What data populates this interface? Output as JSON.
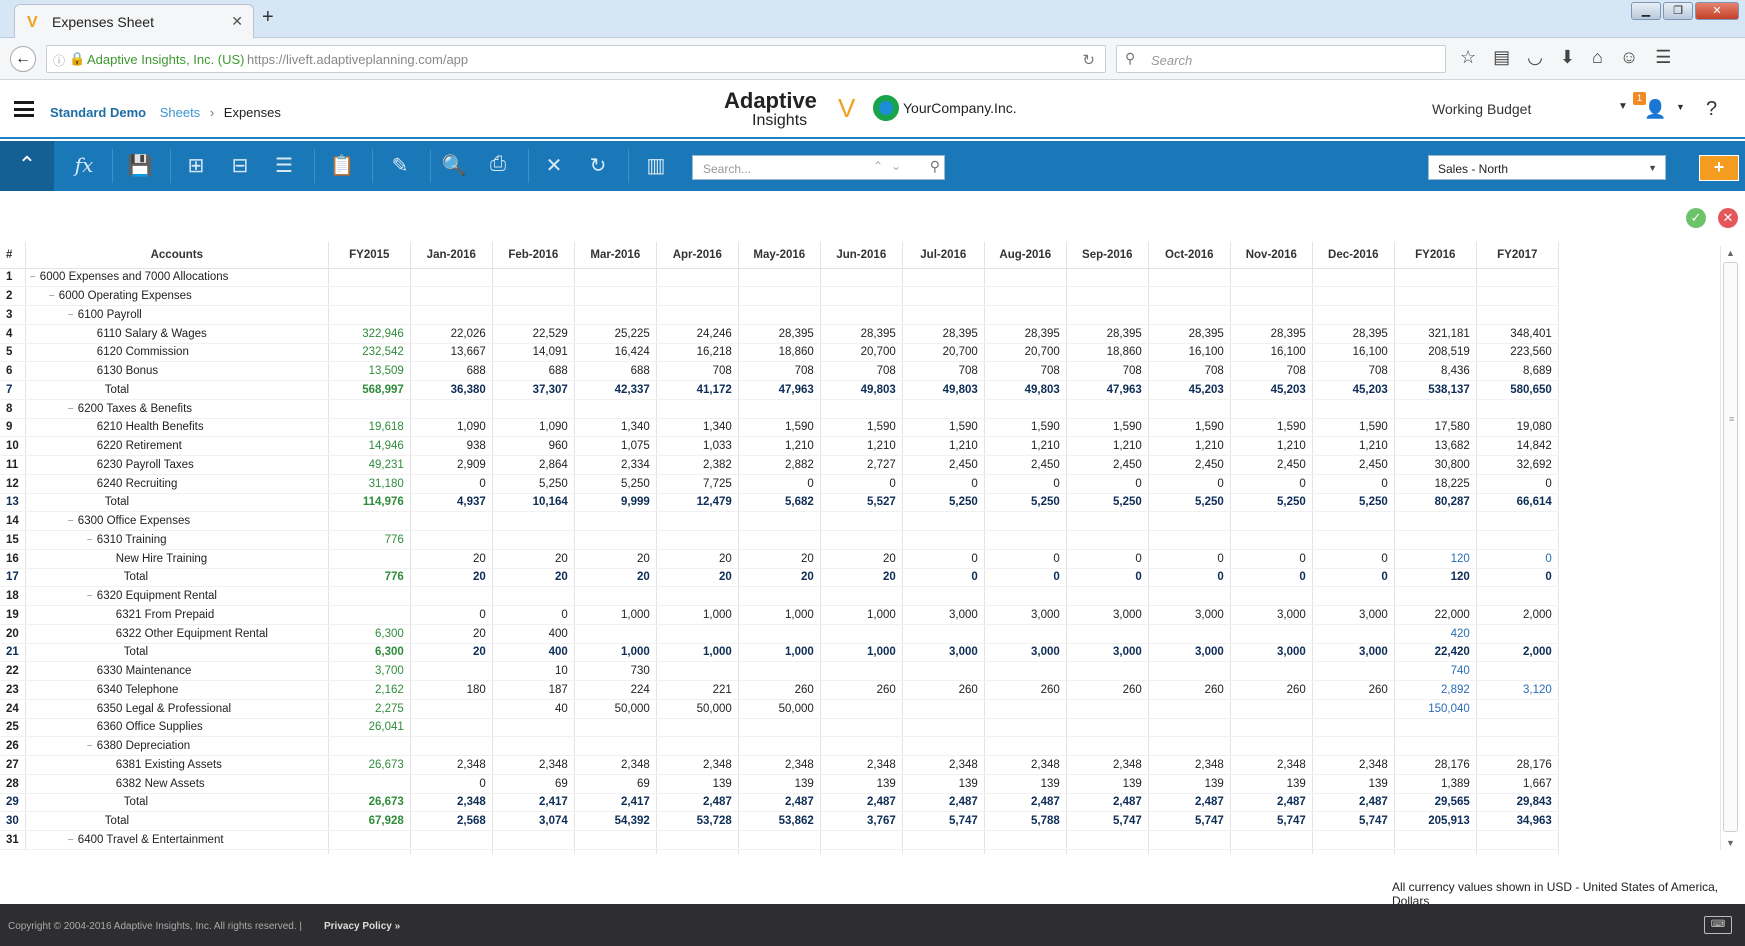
{
  "browser": {
    "tab_title": "Expenses Sheet",
    "new_tab": "+",
    "site_org": "Adaptive Insights, Inc. (US)",
    "url": "https://liveft.adaptiveplanning.com/app",
    "search_placeholder": "Search"
  },
  "header": {
    "breadcrumb": {
      "root": "Standard Demo",
      "section": "Sheets",
      "separator": "›",
      "current": "Expenses"
    },
    "brand_line1": "Adaptive",
    "brand_line2": "Insights",
    "company": "YourCompany.Inc.",
    "version": "Working Budget",
    "notifications": "1",
    "help": "?"
  },
  "toolbar": {
    "search_placeholder": "Search...",
    "sheet_selector": "Sales - North",
    "add_label": "+"
  },
  "grid": {
    "columns": [
      "#",
      "Accounts",
      "FY2015",
      "Jan-2016",
      "Feb-2016",
      "Mar-2016",
      "Apr-2016",
      "May-2016",
      "Jun-2016",
      "Jul-2016",
      "Aug-2016",
      "Sep-2016",
      "Oct-2016",
      "Nov-2016",
      "Dec-2016",
      "FY2016",
      "FY2017"
    ],
    "rows": [
      {
        "n": "1",
        "indent": 0,
        "toggle": "−",
        "account": "6000 Expenses and 7000 Allocations",
        "values": [
          "",
          "",
          "",
          "",
          "",
          "",
          "",
          "",
          "",
          "",
          "",
          "",
          "",
          "",
          ""
        ]
      },
      {
        "n": "2",
        "indent": 1,
        "toggle": "−",
        "account": "6000 Operating Expenses",
        "values": [
          "",
          "",
          "",
          "",
          "",
          "",
          "",
          "",
          "",
          "",
          "",
          "",
          "",
          "",
          ""
        ]
      },
      {
        "n": "3",
        "indent": 2,
        "toggle": "−",
        "account": "6100 Payroll",
        "values": [
          "",
          "",
          "",
          "",
          "",
          "",
          "",
          "",
          "",
          "",
          "",
          "",
          "",
          "",
          ""
        ]
      },
      {
        "n": "4",
        "indent": 3,
        "account": "6110 Salary & Wages",
        "values": [
          "322,946",
          "22,026",
          "22,529",
          "25,225",
          "24,246",
          "28,395",
          "28,395",
          "28,395",
          "28,395",
          "28,395",
          "28,395",
          "28,395",
          "28,395",
          "321,181",
          "348,401"
        ]
      },
      {
        "n": "5",
        "indent": 3,
        "account": "6120 Commission",
        "values": [
          "232,542",
          "13,667",
          "14,091",
          "16,424",
          "16,218",
          "18,860",
          "20,700",
          "20,700",
          "20,700",
          "18,860",
          "16,100",
          "16,100",
          "16,100",
          "208,519",
          "223,560"
        ]
      },
      {
        "n": "6",
        "indent": 3,
        "account": "6130 Bonus",
        "values": [
          "13,509",
          "688",
          "688",
          "688",
          "708",
          "708",
          "708",
          "708",
          "708",
          "708",
          "708",
          "708",
          "708",
          "8,436",
          "8,689"
        ]
      },
      {
        "n": "7",
        "indent": 3,
        "total": true,
        "account": "Total",
        "values": [
          "568,997",
          "36,380",
          "37,307",
          "42,337",
          "41,172",
          "47,963",
          "49,803",
          "49,803",
          "49,803",
          "47,963",
          "45,203",
          "45,203",
          "45,203",
          "538,137",
          "580,650"
        ]
      },
      {
        "n": "8",
        "indent": 2,
        "toggle": "−",
        "account": "6200 Taxes & Benefits",
        "values": [
          "",
          "",
          "",
          "",
          "",
          "",
          "",
          "",
          "",
          "",
          "",
          "",
          "",
          "",
          ""
        ]
      },
      {
        "n": "9",
        "indent": 3,
        "account": "6210 Health Benefits",
        "values": [
          "19,618",
          "1,090",
          "1,090",
          "1,340",
          "1,340",
          "1,590",
          "1,590",
          "1,590",
          "1,590",
          "1,590",
          "1,590",
          "1,590",
          "1,590",
          "17,580",
          "19,080"
        ]
      },
      {
        "n": "10",
        "indent": 3,
        "account": "6220 Retirement",
        "values": [
          "14,946",
          "938",
          "960",
          "1,075",
          "1,033",
          "1,210",
          "1,210",
          "1,210",
          "1,210",
          "1,210",
          "1,210",
          "1,210",
          "1,210",
          "13,682",
          "14,842"
        ]
      },
      {
        "n": "11",
        "indent": 3,
        "account": "6230 Payroll Taxes",
        "values": [
          "49,231",
          "2,909",
          "2,864",
          "2,334",
          "2,382",
          "2,882",
          "2,727",
          "2,450",
          "2,450",
          "2,450",
          "2,450",
          "2,450",
          "2,450",
          "30,800",
          "32,692"
        ]
      },
      {
        "n": "12",
        "indent": 3,
        "account": "6240 Recruiting",
        "values": [
          "31,180",
          "0",
          "5,250",
          "5,250",
          "7,725",
          "0",
          "0",
          "0",
          "0",
          "0",
          "0",
          "0",
          "0",
          "18,225",
          "0"
        ]
      },
      {
        "n": "13",
        "indent": 3,
        "total": true,
        "account": "Total",
        "values": [
          "114,976",
          "4,937",
          "10,164",
          "9,999",
          "12,479",
          "5,682",
          "5,527",
          "5,250",
          "5,250",
          "5,250",
          "5,250",
          "5,250",
          "5,250",
          "80,287",
          "66,614"
        ]
      },
      {
        "n": "14",
        "indent": 2,
        "toggle": "−",
        "account": "6300 Office Expenses",
        "values": [
          "",
          "",
          "",
          "",
          "",
          "",
          "",
          "",
          "",
          "",
          "",
          "",
          "",
          "",
          ""
        ]
      },
      {
        "n": "15",
        "indent": 3,
        "toggle": "−",
        "account": "6310 Training",
        "values": [
          "776",
          "",
          "",
          "",
          "",
          "",
          "",
          "",
          "",
          "",
          "",
          "",
          "",
          "",
          ""
        ]
      },
      {
        "n": "16",
        "indent": 4,
        "account": "New Hire Training",
        "values": [
          "",
          "20",
          "20",
          "20",
          "20",
          "20",
          "20",
          "0",
          "0",
          "0",
          "0",
          "0",
          "0",
          "120",
          "0"
        ],
        "blue_fy": true
      },
      {
        "n": "17",
        "indent": 4,
        "total": true,
        "account": "Total",
        "values": [
          "776",
          "20",
          "20",
          "20",
          "20",
          "20",
          "20",
          "0",
          "0",
          "0",
          "0",
          "0",
          "0",
          "120",
          "0"
        ]
      },
      {
        "n": "18",
        "indent": 3,
        "toggle": "−",
        "account": "6320 Equipment Rental",
        "values": [
          "",
          "",
          "",
          "",
          "",
          "",
          "",
          "",
          "",
          "",
          "",
          "",
          "",
          "",
          ""
        ]
      },
      {
        "n": "19",
        "indent": 4,
        "account": "6321 From Prepaid",
        "values": [
          "",
          "0",
          "0",
          "1,000",
          "1,000",
          "1,000",
          "1,000",
          "3,000",
          "3,000",
          "3,000",
          "3,000",
          "3,000",
          "3,000",
          "22,000",
          "2,000"
        ]
      },
      {
        "n": "20",
        "indent": 4,
        "account": "6322 Other Equipment Rental",
        "values": [
          "6,300",
          "20",
          "400",
          "",
          "",
          "",
          "",
          "",
          "",
          "",
          "",
          "",
          "",
          "420",
          ""
        ],
        "blue_fy": true
      },
      {
        "n": "21",
        "indent": 4,
        "total": true,
        "account": "Total",
        "values": [
          "6,300",
          "20",
          "400",
          "1,000",
          "1,000",
          "1,000",
          "1,000",
          "3,000",
          "3,000",
          "3,000",
          "3,000",
          "3,000",
          "3,000",
          "22,420",
          "2,000"
        ]
      },
      {
        "n": "22",
        "indent": 3,
        "account": "6330 Maintenance",
        "values": [
          "3,700",
          "",
          "10",
          "730",
          "",
          "",
          "",
          "",
          "",
          "",
          "",
          "",
          "",
          "740",
          ""
        ],
        "blue_fy": true
      },
      {
        "n": "23",
        "indent": 3,
        "account": "6340 Telephone",
        "values": [
          "2,162",
          "180",
          "187",
          "224",
          "221",
          "260",
          "260",
          "260",
          "260",
          "260",
          "260",
          "260",
          "260",
          "2,892",
          "3,120"
        ],
        "blue_fy": true
      },
      {
        "n": "24",
        "indent": 3,
        "account": "6350 Legal & Professional",
        "values": [
          "2,275",
          "",
          "40",
          "50,000",
          "50,000",
          "50,000",
          "",
          "",
          "",
          "",
          "",
          "",
          "",
          "150,040",
          ""
        ],
        "blue_fy": true
      },
      {
        "n": "25",
        "indent": 3,
        "account": "6360 Office Supplies",
        "values": [
          "26,041",
          "",
          "",
          "",
          "",
          "",
          "",
          "",
          "",
          "",
          "",
          "",
          "",
          "",
          ""
        ]
      },
      {
        "n": "26",
        "indent": 3,
        "toggle": "−",
        "account": "6380 Depreciation",
        "values": [
          "",
          "",
          "",
          "",
          "",
          "",
          "",
          "",
          "",
          "",
          "",
          "",
          "",
          "",
          ""
        ]
      },
      {
        "n": "27",
        "indent": 4,
        "account": "6381 Existing Assets",
        "values": [
          "26,673",
          "2,348",
          "2,348",
          "2,348",
          "2,348",
          "2,348",
          "2,348",
          "2,348",
          "2,348",
          "2,348",
          "2,348",
          "2,348",
          "2,348",
          "28,176",
          "28,176"
        ]
      },
      {
        "n": "28",
        "indent": 4,
        "account": "6382 New Assets",
        "values": [
          "",
          "0",
          "69",
          "69",
          "139",
          "139",
          "139",
          "139",
          "139",
          "139",
          "139",
          "139",
          "139",
          "1,389",
          "1,667"
        ]
      },
      {
        "n": "29",
        "indent": 4,
        "total": true,
        "account": "Total",
        "values": [
          "26,673",
          "2,348",
          "2,417",
          "2,417",
          "2,487",
          "2,487",
          "2,487",
          "2,487",
          "2,487",
          "2,487",
          "2,487",
          "2,487",
          "2,487",
          "29,565",
          "29,843"
        ]
      },
      {
        "n": "30",
        "indent": 3,
        "total": true,
        "account": "Total",
        "values": [
          "67,928",
          "2,568",
          "3,074",
          "54,392",
          "53,728",
          "53,862",
          "3,767",
          "5,747",
          "5,788",
          "5,747",
          "5,747",
          "5,747",
          "5,747",
          "205,913",
          "34,963"
        ]
      },
      {
        "n": "31",
        "indent": 2,
        "toggle": "−",
        "account": "6400 Travel & Entertainment",
        "values": [
          "",
          "",
          "",
          "",
          "",
          "",
          "",
          "",
          "",
          "",
          "",
          "",
          "",
          "",
          ""
        ]
      }
    ]
  },
  "currency_note": "All currency values shown in USD - United States of America, Dollars",
  "footer": {
    "copyright": "Copyright © 2004-2016 Adaptive Insights, Inc. All rights reserved.  |",
    "privacy": "Privacy Policy »"
  },
  "colors": {
    "toolbar": "#1a78b8",
    "accent": "#f39c1f",
    "fy2015": "#2f8c3a",
    "totals": "#0e2d57"
  }
}
